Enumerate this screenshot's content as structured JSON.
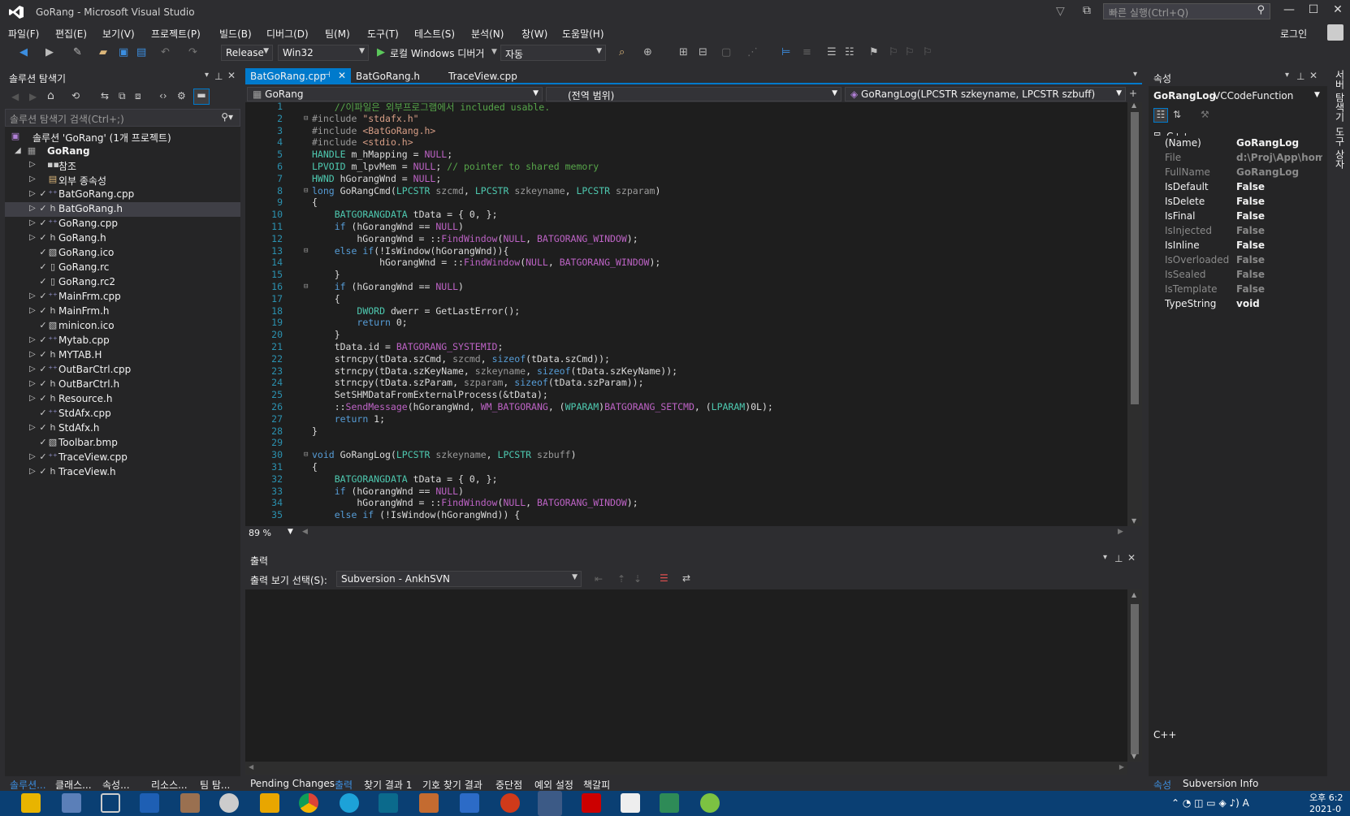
{
  "window": {
    "title": "GoRang - Microsoft Visual Studio",
    "quick_launch_placeholder": "빠른 실행(Ctrl+Q)",
    "login": "로그인"
  },
  "menu": [
    "파일(F)",
    "편집(E)",
    "보기(V)",
    "프로젝트(P)",
    "빌드(B)",
    "디버그(D)",
    "팀(M)",
    "도구(T)",
    "테스트(S)",
    "분석(N)",
    "창(W)",
    "도움말(H)"
  ],
  "toolbar": {
    "configuration": "Release",
    "platform": "Win32",
    "run_label": "로컬 Windows 디버거",
    "run_mode": "자동"
  },
  "solution_explorer": {
    "title": "솔루션 탐색기",
    "search_placeholder": "솔루션 탐색기 검색(Ctrl+;)",
    "solution": "솔루션 'GoRang' (1개 프로젝트)",
    "project": "GoRang",
    "items": [
      "참조",
      "외부 종속성",
      "BatGoRang.cpp",
      "BatGoRang.h",
      "GoRang.cpp",
      "GoRang.h",
      "GoRang.ico",
      "GoRang.rc",
      "GoRang.rc2",
      "MainFrm.cpp",
      "MainFrm.h",
      "minicon.ico",
      "Mytab.cpp",
      "MYTAB.H",
      "OutBarCtrl.cpp",
      "OutBarCtrl.h",
      "Resource.h",
      "StdAfx.cpp",
      "StdAfx.h",
      "Toolbar.bmp",
      "TraceView.cpp",
      "TraceView.h"
    ],
    "bottom_tabs": [
      "솔루션...",
      "클래스...",
      "속성...",
      "리소스...",
      "팀 탐..."
    ]
  },
  "editor": {
    "tabs": [
      "BatGoRang.cpp",
      "BatGoRang.h",
      "TraceView.cpp"
    ],
    "nav_project": "GoRang",
    "nav_scope": "(전역 범위)",
    "nav_member": "GoRangLog(LPCSTR szkeyname, LPCSTR szbuff)",
    "zoom": "89 %",
    "lines": [
      "    //이파일은 외부프로그램에서 included usable.",
      "#include \"stdafx.h\"",
      "#include <BatGoRang.h>",
      "#include <stdio.h>",
      "HANDLE m_hMapping = NULL;",
      "LPVOID m_lpvMem = NULL; // pointer to shared memory",
      "HWND hGorangWnd = NULL;",
      "long GoRangCmd(LPCSTR szcmd, LPCSTR szkeyname, LPCSTR szparam)",
      "{",
      "    BATGORANGDATA tData = { 0, };",
      "    if (hGorangWnd == NULL)",
      "        hGorangWnd = ::FindWindow(NULL, BATGORANG_WINDOW);",
      "    else if(!IsWindow(hGorangWnd)){",
      "            hGorangWnd = ::FindWindow(NULL, BATGORANG_WINDOW);",
      "    }",
      "    if (hGorangWnd == NULL)",
      "    {",
      "        DWORD dwerr = GetLastError();",
      "        return 0;",
      "    }",
      "    tData.id = BATGORANG_SYSTEMID;",
      "    strncpy(tData.szCmd, szcmd, sizeof(tData.szCmd));",
      "    strncpy(tData.szKeyName, szkeyname, sizeof(tData.szKeyName));",
      "    strncpy(tData.szParam, szparam, sizeof(tData.szParam));",
      "    SetSHMDataFromExternalProcess(&tData);",
      "    ::SendMessage(hGorangWnd, WM_BATGORANG, (WPARAM)BATGORANG_SETCMD, (LPARAM)0L);",
      "    return 1;",
      "}",
      "",
      "void GoRangLog(LPCSTR szkeyname, LPCSTR szbuff)",
      "{",
      "    BATGORANGDATA tData = { 0, };",
      "    if (hGorangWnd == NULL)",
      "        hGorangWnd = ::FindWindow(NULL, BATGORANG_WINDOW);",
      "    else if (!IsWindow(hGorangWnd)) {"
    ]
  },
  "output": {
    "title": "출력",
    "select_label": "출력 보기 선택(S):",
    "source": "Subversion - AnkhSVN",
    "bottom_tabs": [
      "Pending Changes",
      "출력",
      "찾기 결과 1",
      "기호 찾기 결과",
      "중단점",
      "예외 설정",
      "책갈피"
    ]
  },
  "properties": {
    "title": "속성",
    "object_name": "GoRangLog",
    "object_type": "VCCodeFunction",
    "category": "C++",
    "rows": [
      {
        "name": "(Name)",
        "value": "GoRangLog",
        "dim": false
      },
      {
        "name": "File",
        "value": "d:\\Proj\\App\\hom",
        "dim": true
      },
      {
        "name": "FullName",
        "value": "GoRangLog",
        "dim": true
      },
      {
        "name": "IsDefault",
        "value": "False",
        "dim": false
      },
      {
        "name": "IsDelete",
        "value": "False",
        "dim": false
      },
      {
        "name": "IsFinal",
        "value": "False",
        "dim": false
      },
      {
        "name": "IsInjected",
        "value": "False",
        "dim": true
      },
      {
        "name": "IsInline",
        "value": "False",
        "dim": false
      },
      {
        "name": "IsOverloaded",
        "value": "False",
        "dim": true
      },
      {
        "name": "IsSealed",
        "value": "False",
        "dim": true
      },
      {
        "name": "IsTemplate",
        "value": "False",
        "dim": true
      },
      {
        "name": "TypeString",
        "value": "void",
        "dim": false
      }
    ],
    "description": "C++",
    "bottom_tabs": [
      "속성",
      "Subversion Info"
    ]
  },
  "side_tabs": [
    "서버 탐색기",
    "도구 상자"
  ],
  "clock": {
    "time": "오후 6:2",
    "date": "2021-0"
  },
  "colors": {
    "accent": "#007acc",
    "background": "#2d2d30",
    "editor_bg": "#1e1e1e",
    "taskbar": "#0a3f73"
  }
}
